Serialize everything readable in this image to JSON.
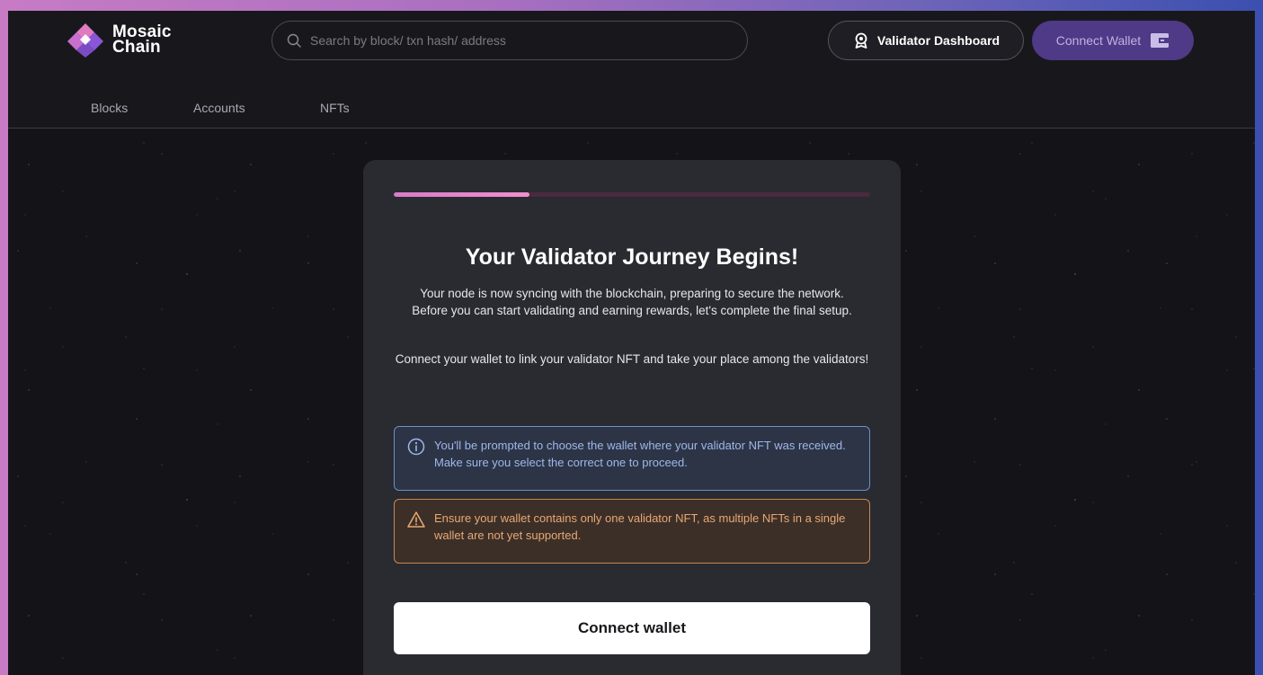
{
  "brand": {
    "line1": "Mosaic",
    "line2": "Chain",
    "logo_icon": "diamond-mosaic-logo-icon",
    "colors": {
      "pink": "#e07bc2",
      "purple": "#8a56d8",
      "white": "#ffffff"
    }
  },
  "search": {
    "placeholder": "Search by block/ txn hash/ address",
    "icon": "search-icon"
  },
  "header": {
    "validator_dashboard_label": "Validator Dashboard",
    "validator_icon": "badge-icon",
    "connect_wallet_label": "Connect Wallet",
    "wallet_icon": "wallet-icon"
  },
  "nav": {
    "items": [
      {
        "label": "Blocks"
      },
      {
        "label": "Accounts"
      },
      {
        "label": "NFTs"
      }
    ]
  },
  "card": {
    "progress_fraction": 0.285,
    "title": "Your Validator Journey Begins!",
    "description": "Your node is now syncing with the blockchain, preparing to secure the network. Before you can start validating and earning rewards, let's complete the final setup.",
    "description2": "Connect your wallet to link your validator NFT and take your place among the validators!",
    "info_alert": {
      "icon": "info-icon",
      "text": "You'll be prompted to choose the wallet where your validator NFT was received. Make sure you select the correct one to proceed."
    },
    "warning_alert": {
      "icon": "warning-icon",
      "text": "Ensure your wallet contains only one validator NFT, as multiple NFTs in a single wallet are not yet supported."
    },
    "connect_button_label": "Connect wallet"
  },
  "colors": {
    "accent_purple": "#4e3a86",
    "progress_pink": "#e687cc",
    "info_border": "#6f8fc6",
    "warning_border": "#c58855"
  }
}
